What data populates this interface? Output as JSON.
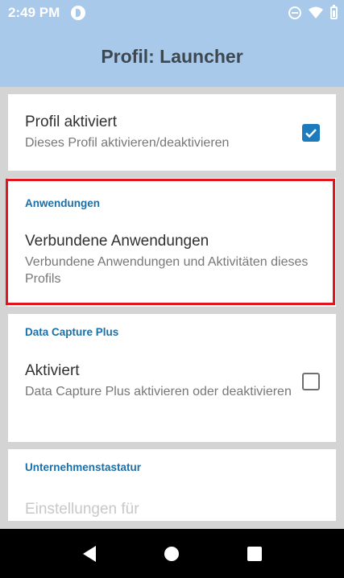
{
  "status_bar": {
    "time": "2:49 PM",
    "icons": [
      "app-icon",
      "do-not-disturb-icon",
      "wifi-icon",
      "battery-icon"
    ]
  },
  "app_bar": {
    "title": "Profil: Launcher"
  },
  "sections": {
    "profile_enabled": {
      "title": "Profil aktiviert",
      "summary": "Dieses Profil aktivieren/deaktivieren",
      "checked": true
    },
    "applications": {
      "category": "Anwendungen",
      "title": "Verbundene Anwendungen",
      "summary": "Verbundene Anwendungen und Aktivitäten dieses Profils"
    },
    "data_capture_plus": {
      "category": "Data Capture Plus",
      "title": "Aktiviert",
      "summary": "Data Capture Plus aktivieren oder deaktivieren",
      "checked": false
    },
    "enterprise_keyboard": {
      "category": "Unternehmenstastatur",
      "title": "Einstellungen für"
    }
  },
  "colors": {
    "accent": "#1c7bbd",
    "app_bar": "#a9c9ea",
    "highlight": "#e0151e"
  }
}
